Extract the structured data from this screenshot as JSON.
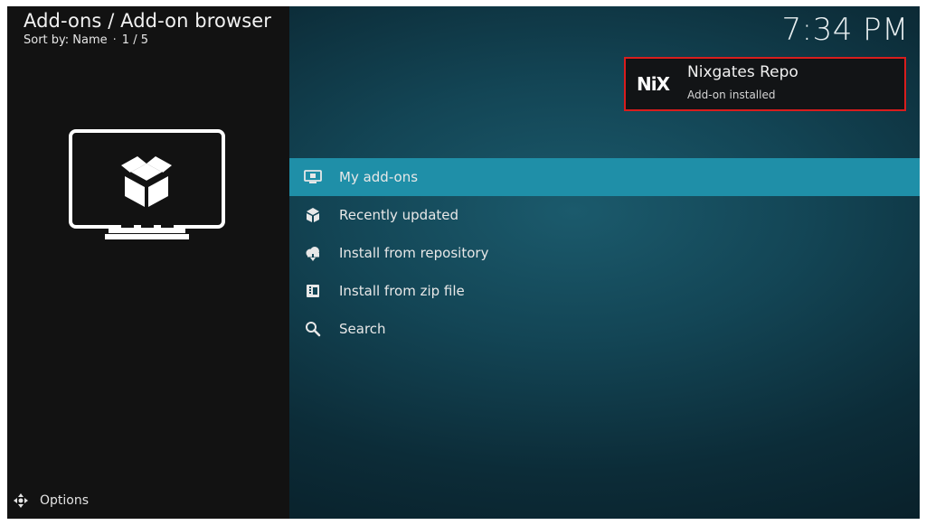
{
  "header": {
    "title": "Add-ons / Add-on browser",
    "sort_label": "Sort by: Name",
    "separator": "·",
    "page_position": "1 / 5"
  },
  "clock": "7:34 PM",
  "notification": {
    "logo_text": "NiX",
    "title": "Nixgates Repo",
    "message": "Add-on installed",
    "border_color": "#d81d1d"
  },
  "menu": {
    "items": [
      {
        "label": "My add-ons",
        "icon": "monitor-box-icon",
        "focused": true
      },
      {
        "label": "Recently updated",
        "icon": "box-refresh-icon",
        "focused": false
      },
      {
        "label": "Install from repository",
        "icon": "cloud-download-icon",
        "focused": false
      },
      {
        "label": "Install from zip file",
        "icon": "zip-file-icon",
        "focused": false
      },
      {
        "label": "Search",
        "icon": "search-icon",
        "focused": false
      }
    ]
  },
  "options": {
    "label": "Options"
  },
  "theme": {
    "focus_color": "#1f8fa8",
    "panel_color": "#121212"
  }
}
